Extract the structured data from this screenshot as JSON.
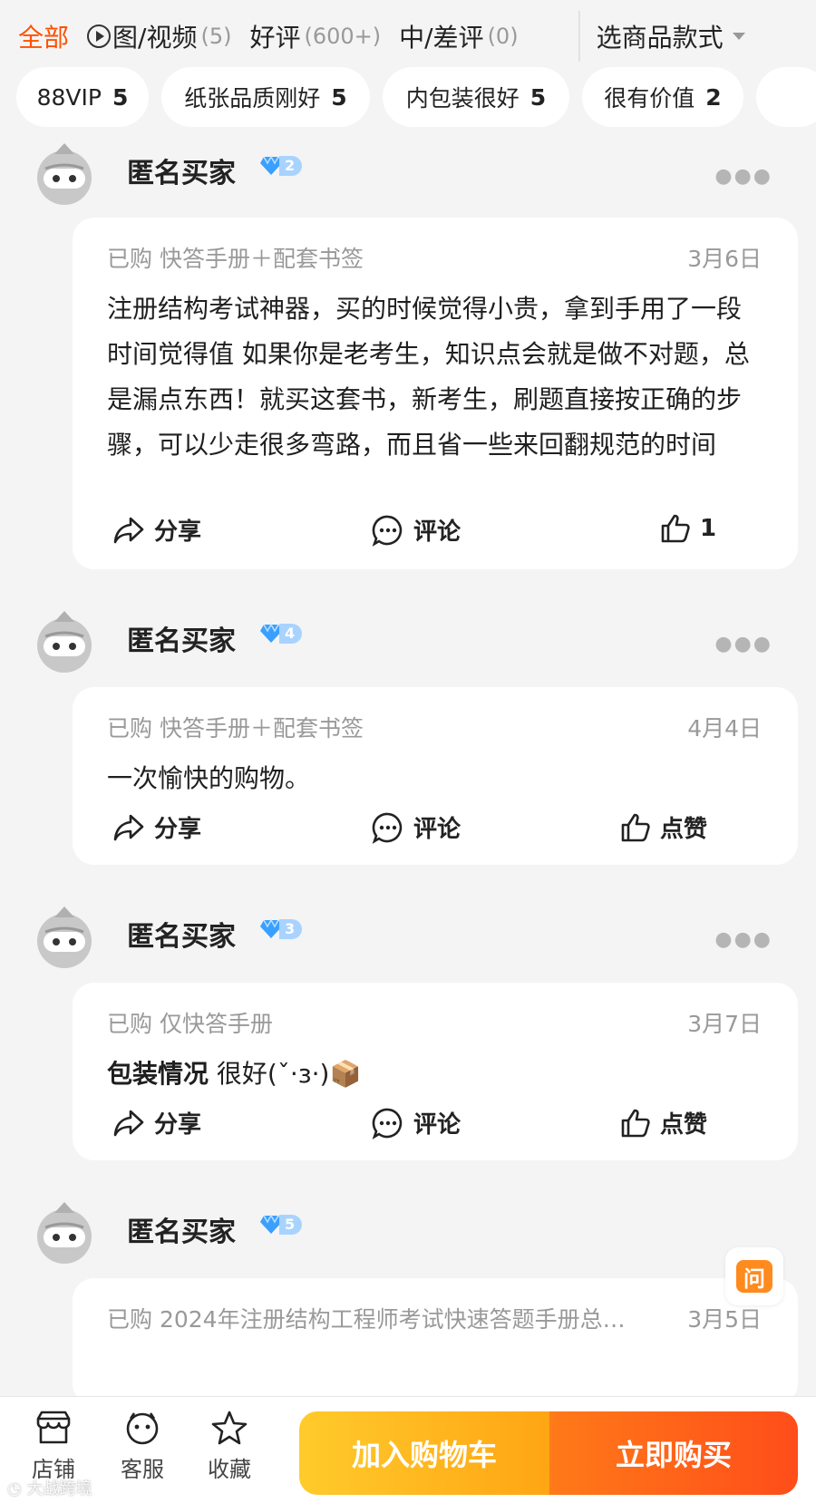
{
  "tabs": [
    {
      "label": "全部",
      "count": ""
    },
    {
      "label": "图/视频",
      "count": "(5)"
    },
    {
      "label": "好评",
      "count": "(600+)"
    },
    {
      "label": "中/差评",
      "count": "(0)"
    }
  ],
  "style_select": "选商品款式",
  "chips": [
    {
      "label": "88VIP",
      "count": "5"
    },
    {
      "label": "纸张品质刚好",
      "count": "5"
    },
    {
      "label": "内包装很好",
      "count": "5"
    },
    {
      "label": "很有价值",
      "count": "2"
    }
  ],
  "actions": {
    "share": "分享",
    "comment": "评论",
    "like": "点赞"
  },
  "reviews": [
    {
      "buyer": "匿名买家",
      "level": "2",
      "meta": "已购 快答手册＋配套书签",
      "date": "3月6日",
      "content": "注册结构考试神器，买的时候觉得小贵，拿到手用了一段时间觉得值 如果你是老考生，知识点会就是做不对题，总是漏点东西！就买这套书，新考生，刷题直接按正确的步骤，可以少走很多弯路，而且省一些来回翻规范的时间",
      "likes": "1"
    },
    {
      "buyer": "匿名买家",
      "level": "4",
      "meta": "已购 快答手册＋配套书签",
      "date": "4月4日",
      "content": "一次愉快的购物。"
    },
    {
      "buyer": "匿名买家",
      "level": "3",
      "meta": "已购 仅快答手册",
      "date": "3月7日",
      "content_bold": "包装情况",
      "content": "很好(ˇ·з·)📦"
    },
    {
      "buyer": "匿名买家",
      "level": "5",
      "meta": "已购 2024年注册结构工程师考试快速答题手册总…",
      "date": "3月5日"
    }
  ],
  "ask_button": "问",
  "bottom_nav": {
    "shop": "店铺",
    "service": "客服",
    "favorite": "收藏"
  },
  "add_to_cart": "加入购物车",
  "buy_now": "立即购买",
  "watermark": "大战跨境",
  "colors": {
    "accent": "#ff5000",
    "cart": "#ffb21e",
    "buy": "#ff5a1a",
    "diamond": "#3aa0ff"
  }
}
